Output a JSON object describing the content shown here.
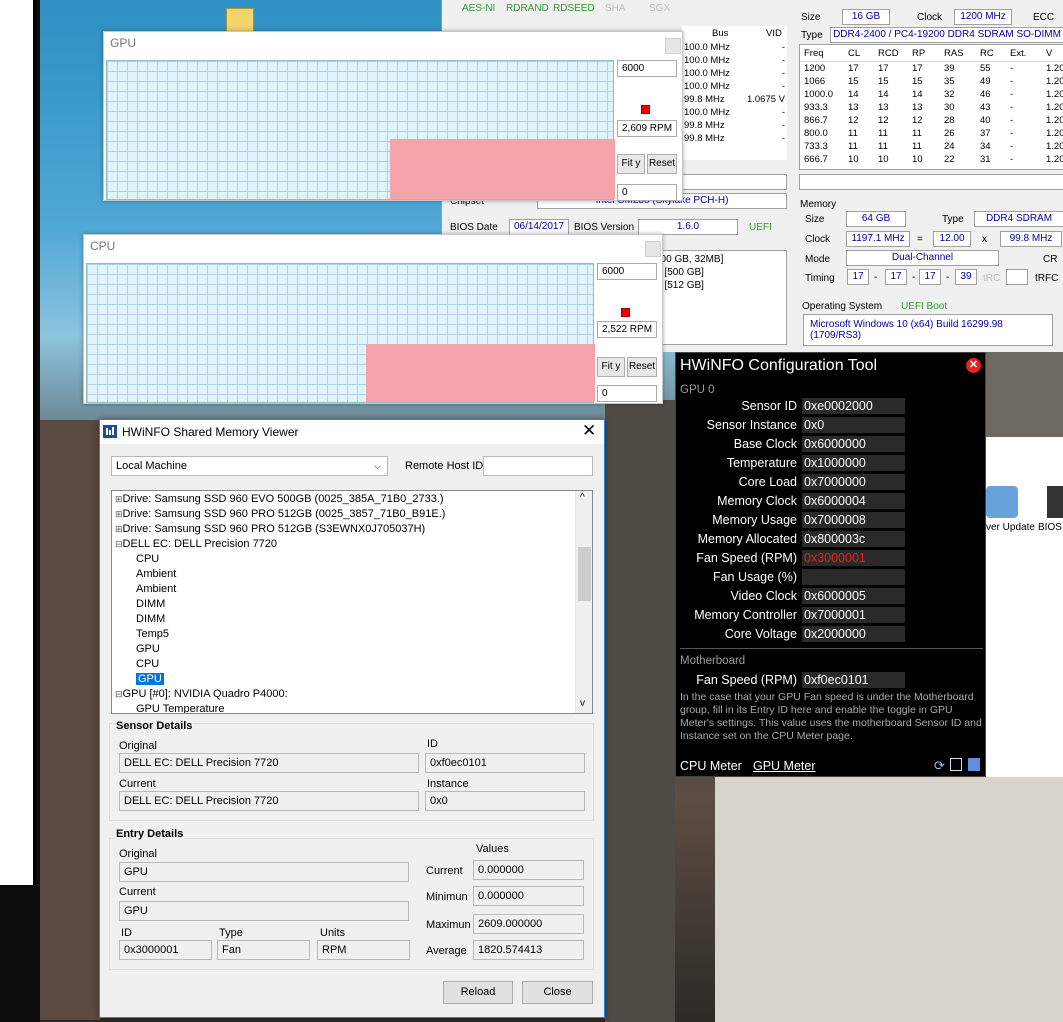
{
  "summary": {
    "cpu_features": [
      "AES-NI",
      "RDRAND",
      "RDSEED",
      "SHA",
      "SGX"
    ],
    "bus_header": "Bus",
    "vid_header": "VID",
    "bus_rows": [
      {
        "bus": "100.0 MHz",
        "vid": "-"
      },
      {
        "bus": "100.0 MHz",
        "vid": "-"
      },
      {
        "bus": "100.0 MHz",
        "vid": "-"
      },
      {
        "bus": "100.0 MHz",
        "vid": "-"
      },
      {
        "bus": "99.8 MHz",
        "vid": "1.0675 V"
      },
      {
        "bus": "100.0 MHz",
        "vid": "-"
      },
      {
        "bus": "99.8 MHz",
        "vid": "-"
      },
      {
        "bus": "99.8 MHz",
        "vid": "-"
      }
    ],
    "chipset_label": "Chipset",
    "chipset_value": "Intel CM238 (Skylake PCH-H)",
    "bios_date_label": "BIOS Date",
    "bios_date": "06/14/2017",
    "bios_version_label": "BIOS Version",
    "bios_version": "1.6.0",
    "uefi": "UEFI",
    "drives": [
      "000 GB, 32MB]",
      "B [500 GB]",
      "B [512 GB]"
    ],
    "module": {
      "size_label": "Size",
      "size": "16 GB",
      "clock_label": "Clock",
      "clock": "1200 MHz",
      "ecc_label": "ECC",
      "type_label": "Type",
      "type": "DDR4-2400 / PC4-19200 DDR4 SDRAM SO-DIMM"
    },
    "timing_headers": [
      "Freq",
      "CL",
      "RCD",
      "RP",
      "RAS",
      "RC",
      "Ext.",
      "V"
    ],
    "timing_rows": [
      [
        "1200",
        "17",
        "17",
        "17",
        "39",
        "55",
        "-",
        "1.20"
      ],
      [
        "1066",
        "15",
        "15",
        "15",
        "35",
        "49",
        "-",
        "1.20"
      ],
      [
        "1000.0",
        "14",
        "14",
        "14",
        "32",
        "46",
        "-",
        "1.20"
      ],
      [
        "933.3",
        "13",
        "13",
        "13",
        "30",
        "43",
        "-",
        "1.20"
      ],
      [
        "866.7",
        "12",
        "12",
        "12",
        "28",
        "40",
        "-",
        "1.20"
      ],
      [
        "800.0",
        "11",
        "11",
        "11",
        "26",
        "37",
        "-",
        "1.20"
      ],
      [
        "733.3",
        "11",
        "11",
        "11",
        "24",
        "34",
        "-",
        "1.20"
      ],
      [
        "666.7",
        "10",
        "10",
        "10",
        "22",
        "31",
        "-",
        "1.20"
      ]
    ],
    "memory": {
      "section": "Memory",
      "size_label": "Size",
      "size": "64 GB",
      "type_label": "Type",
      "type": "DDR4 SDRAM",
      "clock_label": "Clock",
      "clock": "1197.1 MHz",
      "eq": "=",
      "mult": "12.00",
      "x": "x",
      "bclk": "99.8 MHz",
      "mode_label": "Mode",
      "mode": "Dual-Channel",
      "cr": "CR",
      "timing_label": "Timing",
      "t1": "17",
      "t2": "17",
      "t3": "17",
      "t4": "39",
      "trc": "tRC",
      "trfc": "tRFC"
    },
    "os_label": "Operating System",
    "os_boot": "UEFI Boot",
    "os_value": "Microsoft Windows 10  (x64) Build 16299.98 (1709/RS3)",
    "shortcuts": [
      "ver Update",
      "BIOS"
    ]
  },
  "gpu_graph": {
    "title": "GPU",
    "max": "6000",
    "current": "2,609 RPM",
    "min": "0",
    "fit_label": "Fit y",
    "reset_label": "Reset",
    "fill_level": 0.435
  },
  "cpu_graph": {
    "title": "CPU",
    "max": "6000",
    "current": "2,522 RPM",
    "min": "0",
    "fit_label": "Fit y",
    "reset_label": "Reset",
    "fill_level": 0.42
  },
  "smv": {
    "title": "HWiNFO Shared Memory Viewer",
    "machine": "Local Machine",
    "remote_label": "Remote Host ID",
    "remote_value": "",
    "tree": [
      {
        "text": "Drive: Samsung SSD 960 EVO 500GB (0025_385A_71B0_2733.)",
        "level": 0,
        "expand": "plus"
      },
      {
        "text": "Drive: Samsung SSD 960 PRO 512GB (0025_3857_71B0_B91E.)",
        "level": 0,
        "expand": "plus"
      },
      {
        "text": "Drive: Samsung SSD 960 PRO 512GB (S3EWNX0J705037H)",
        "level": 0,
        "expand": "plus"
      },
      {
        "text": "DELL EC: DELL Precision 7720",
        "level": 0,
        "expand": "minus"
      },
      {
        "text": "CPU",
        "level": 1
      },
      {
        "text": "Ambient",
        "level": 1
      },
      {
        "text": "Ambient",
        "level": 1
      },
      {
        "text": "DIMM",
        "level": 1
      },
      {
        "text": "DIMM",
        "level": 1
      },
      {
        "text": "Temp5",
        "level": 1
      },
      {
        "text": "GPU",
        "level": 1
      },
      {
        "text": "CPU",
        "level": 1
      },
      {
        "text": "GPU",
        "level": 1,
        "selected": true
      },
      {
        "text": "GPU [#0]: NVIDIA Quadro P4000:",
        "level": 0,
        "expand": "minus"
      },
      {
        "text": "GPU Temperature",
        "level": 1
      }
    ],
    "sensor_details": {
      "heading": "Sensor Details",
      "original_label": "Original",
      "original": "DELL EC: DELL Precision 7720",
      "id_label": "ID",
      "id": "0xf0ec0101",
      "current_label": "Current",
      "current": "DELL EC: DELL Precision 7720",
      "instance_label": "Instance",
      "instance": "0x0"
    },
    "entry_details": {
      "heading": "Entry Details",
      "original_label": "Original",
      "original": "GPU",
      "current_label": "Current",
      "current": "GPU",
      "id_label": "ID",
      "id": "0x3000001",
      "type_label": "Type",
      "type": "Fan",
      "units_label": "Units",
      "units": "RPM",
      "values_heading": "Values",
      "cur_label": "Current",
      "cur": "0.000000",
      "min_label": "Minimun",
      "min": "0.000000",
      "max_label": "Maximun",
      "max": "2609.000000",
      "avg_label": "Average",
      "avg": "1820.574413"
    },
    "reload_label": "Reload",
    "close_label": "Close"
  },
  "cfg": {
    "title": "HWiNFO Configuration Tool",
    "gpu_section": "GPU 0",
    "rows": [
      {
        "k": "Sensor ID",
        "v": "0xe0002000"
      },
      {
        "k": "Sensor Instance",
        "v": "0x0"
      },
      {
        "k": "Base Clock",
        "v": "0x6000000"
      },
      {
        "k": "Temperature",
        "v": "0x1000000"
      },
      {
        "k": "Core Load",
        "v": "0x7000000"
      },
      {
        "k": "Memory Clock",
        "v": "0x6000004"
      },
      {
        "k": "Memory Usage",
        "v": "0x7000008"
      },
      {
        "k": "Memory Allocated",
        "v": "0x800003c"
      },
      {
        "k": "Fan Speed (RPM)",
        "v": "0x3000001",
        "red": true
      },
      {
        "k": "Fan Usage (%)",
        "v": ""
      },
      {
        "k": "Video Clock",
        "v": "0x6000005"
      },
      {
        "k": "Memory Controller",
        "v": "0x7000001"
      },
      {
        "k": "Core Voltage",
        "v": "0x2000000"
      }
    ],
    "mb_section": "Motherboard",
    "mb_row": {
      "k": "Fan Speed (RPM)",
      "v": "0xf0ec0101"
    },
    "help": "In the case that your GPU Fan speed is under the Motherboard group, fill in its Entry ID here and enable the toggle in GPU Meter's settings. This value uses the motherboard Sensor ID and Instance set on the CPU Meter page.",
    "tab_cpu": "CPU Meter",
    "tab_gpu": "GPU Meter",
    "colors": {
      "error": "#e82020",
      "bg": "#000000"
    }
  }
}
